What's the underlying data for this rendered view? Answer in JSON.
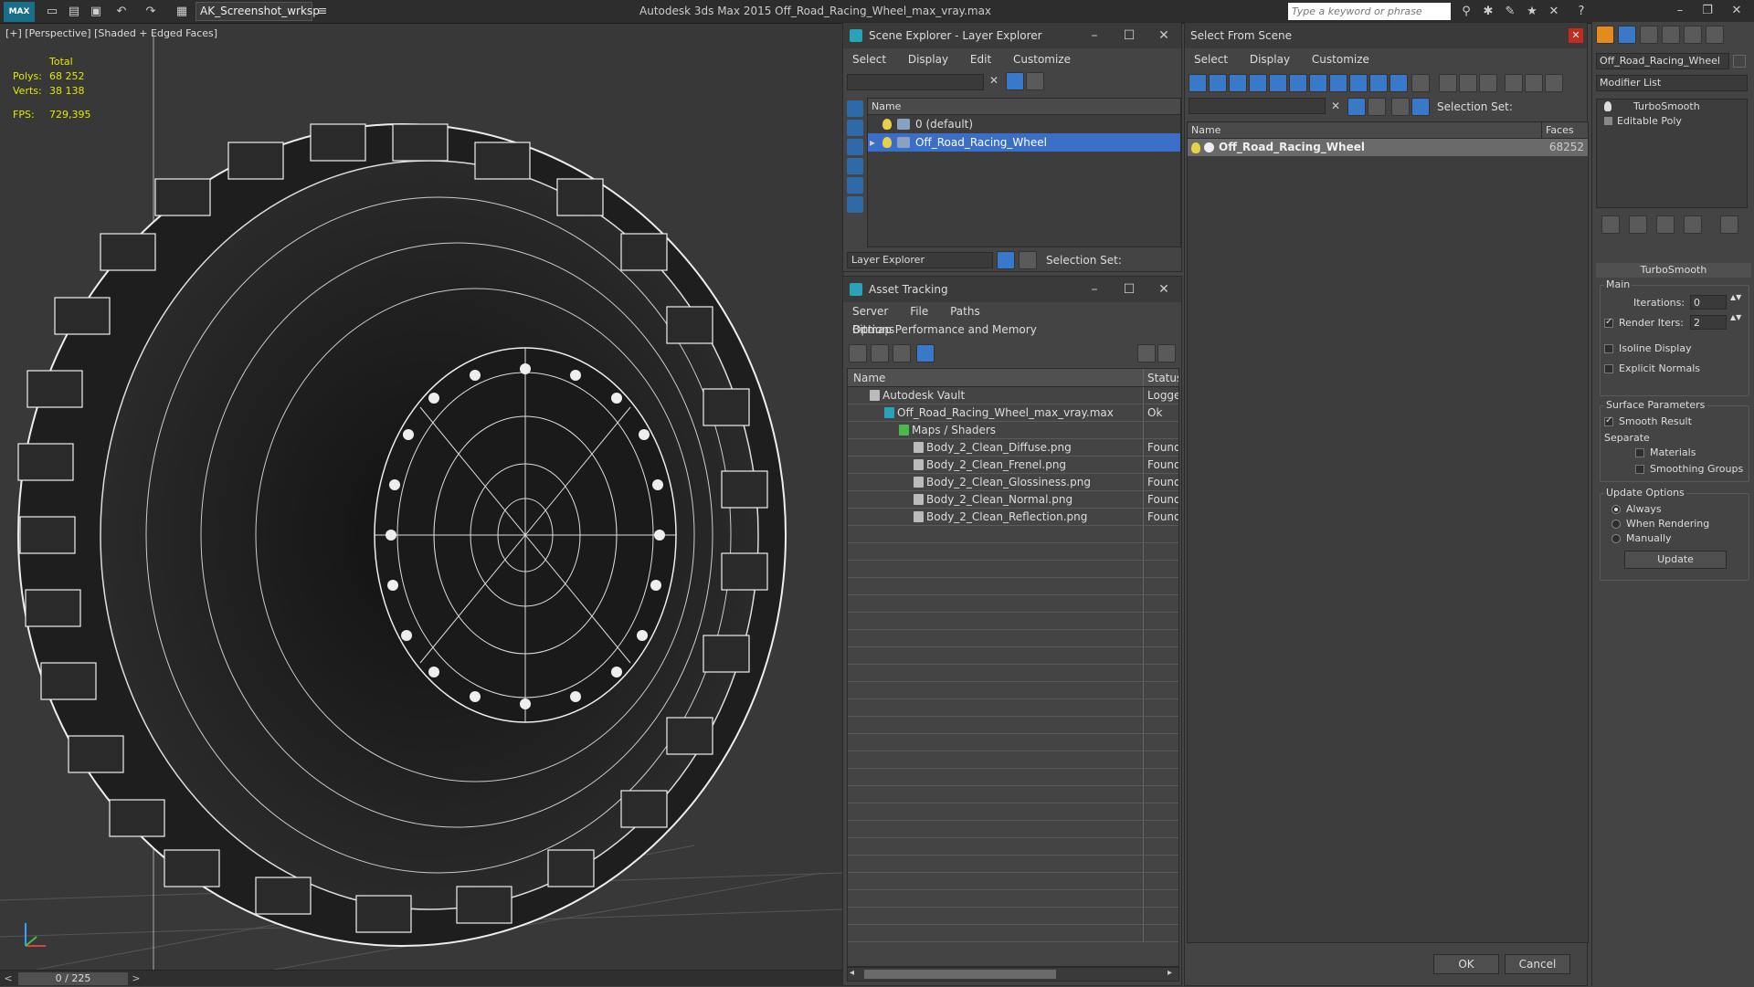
{
  "app": {
    "logo_text": "MAX",
    "workspace": "AK_Screenshot_wrksp",
    "title": "Autodesk 3ds Max  2015    Off_Road_Racing_Wheel_max_vray.max",
    "search_placeholder": "Type a keyword or phrase"
  },
  "viewport": {
    "label": "[+] [Perspective] [Shaded + Edged Faces]",
    "stats": {
      "total_label": "Total",
      "polys_label": "Polys:",
      "polys": "68 252",
      "verts_label": "Verts:",
      "verts": "38 138",
      "fps_label": "FPS:",
      "fps": "729,395"
    }
  },
  "timeline": {
    "frame": "0 / 225",
    "prev": "<",
    "next": ">"
  },
  "scene_explorer": {
    "title": "Scene Explorer - Layer Explorer",
    "menu": [
      "Select",
      "Display",
      "Edit",
      "Customize"
    ],
    "column": "Name",
    "rows": [
      {
        "label": "0 (default)",
        "selected": false
      },
      {
        "label": "Off_Road_Racing_Wheel",
        "selected": true
      }
    ],
    "footer_combo": "Layer Explorer",
    "selection_set_label": "Selection Set:"
  },
  "asset_tracking": {
    "title": "Asset Tracking",
    "menu": [
      "Server",
      "File",
      "Paths",
      "Bitmap Performance and Memory"
    ],
    "menu2": [
      "Options"
    ],
    "columns": {
      "name": "Name",
      "status": "Status"
    },
    "rows": [
      {
        "name": "Autodesk Vault",
        "status": "Logged",
        "indent": 1
      },
      {
        "name": "Off_Road_Racing_Wheel_max_vray.max",
        "status": "Ok",
        "indent": 2
      },
      {
        "name": "Maps / Shaders",
        "status": "",
        "indent": 3
      },
      {
        "name": "Body_2_Clean_Diffuse.png",
        "status": "Found",
        "indent": 4
      },
      {
        "name": "Body_2_Clean_Frenel.png",
        "status": "Found",
        "indent": 4
      },
      {
        "name": "Body_2_Clean_Glossiness.png",
        "status": "Found",
        "indent": 4
      },
      {
        "name": "Body_2_Clean_Normal.png",
        "status": "Found",
        "indent": 4
      },
      {
        "name": "Body_2_Clean_Reflection.png",
        "status": "Found",
        "indent": 4
      }
    ]
  },
  "select_from_scene": {
    "title": "Select From Scene",
    "menu": [
      "Select",
      "Display",
      "Customize"
    ],
    "selection_set_label": "Selection Set:",
    "columns": {
      "name": "Name",
      "faces": "Faces"
    },
    "rows": [
      {
        "name": "Off_Road_Racing_Wheel",
        "faces": "68252"
      }
    ],
    "ok": "OK",
    "cancel": "Cancel"
  },
  "command_panel": {
    "object_name": "Off_Road_Racing_Wheel",
    "modifier_list": "Modifier List",
    "stack": [
      "TurboSmooth",
      "Editable Poly"
    ],
    "rollout_title": "TurboSmooth",
    "main_label": "Main",
    "iterations_label": "Iterations:",
    "iterations": "0",
    "render_iters_label": "Render Iters:",
    "render_iters": "2",
    "isoline_label": "Isoline Display",
    "explicit_normals_label": "Explicit Normals",
    "surface_params_label": "Surface Parameters",
    "smooth_result_label": "Smooth Result",
    "separate_label": "Separate",
    "materials_label": "Materials",
    "smoothing_groups_label": "Smoothing Groups",
    "update_options_label": "Update Options",
    "always_label": "Always",
    "when_rendering_label": "When Rendering",
    "manually_label": "Manually",
    "update_button": "Update"
  }
}
